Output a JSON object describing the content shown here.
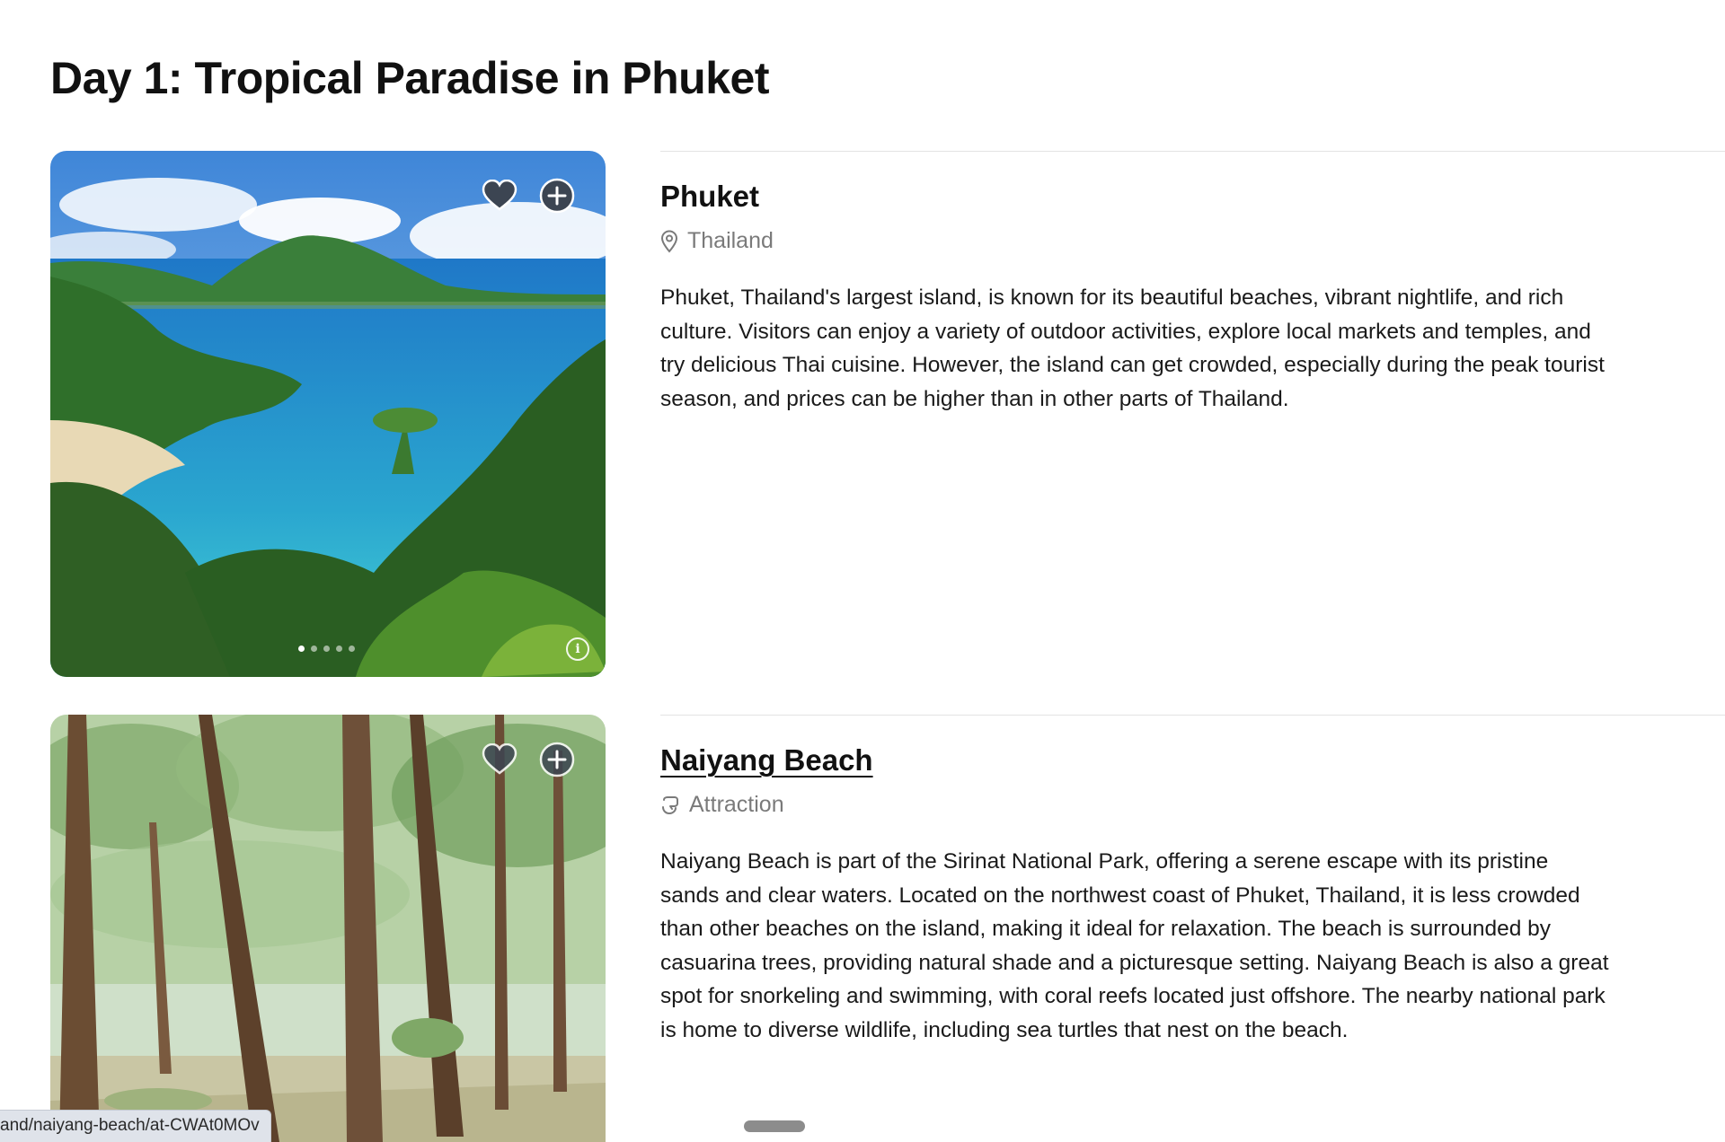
{
  "page": {
    "title": "Day 1: Tropical Paradise in Phuket"
  },
  "places": [
    {
      "name": "Phuket",
      "meta_icon": "location-pin-icon",
      "meta_label": "Thailand",
      "description": "Phuket, Thailand's largest island, is known for its beautiful beaches, vibrant nightlife, and rich culture. Visitors can enjoy a variety of outdoor activities, explore local markets and temples, and try delicious Thai cuisine. However, the island can get crowded, especially during the peak tourist season, and prices can be higher than in other parts of Thailand.",
      "image_subject": "tropical bay with turquoise water, green hills and jungle",
      "carousel_dots": 5,
      "active_dot": 1,
      "favorite_icon": "heart-icon",
      "add_icon": "plus-circle-icon",
      "info_icon": "info-icon",
      "info_glyph": "i"
    },
    {
      "name": "Naiyang Beach",
      "meta_icon": "attraction-icon",
      "meta_label": "Attraction",
      "description": "Naiyang Beach is part of the Sirinat National Park, offering a serene escape with its pristine sands and clear waters. Located on the northwest coast of Phuket, Thailand, it is less crowded than other beaches on the island, making it ideal for relaxation. The beach is surrounded by casuarina trees, providing natural shade and a picturesque setting. Naiyang Beach is also a great spot for snorkeling and swimming, with coral reefs located just offshore. The nearby national park is home to diverse wildlife, including sea turtles that nest on the beach.",
      "image_subject": "casuarina tree forest near the beach",
      "favorite_icon": "heart-icon",
      "add_icon": "plus-circle-icon"
    }
  ],
  "status_bar": {
    "url": "and/naiyang-beach/at-CWAt0MOv"
  },
  "colors": {
    "text": "#111111",
    "muted": "#7a7a7a",
    "divider": "#e3e3e3",
    "icon_bg": "#3c4552"
  }
}
